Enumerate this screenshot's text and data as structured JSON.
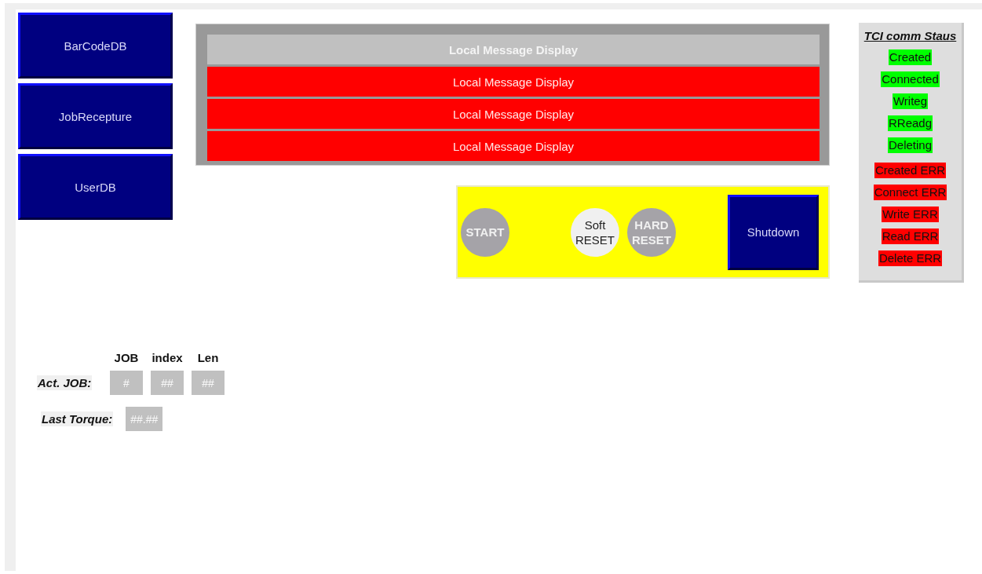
{
  "nav_buttons": [
    {
      "label": "BarCodeDB"
    },
    {
      "label": "JobRecepture"
    },
    {
      "label": "UserDB"
    }
  ],
  "message_display": {
    "header": "Local Message Display",
    "rows": [
      "Local Message Display",
      "Local Message Display",
      "Local Message Display"
    ]
  },
  "controls": {
    "round_buttons": [
      {
        "label": "START",
        "active": false
      },
      {
        "label": "Soft RESET",
        "active": true
      },
      {
        "label": "HARD RESET",
        "active": false
      }
    ],
    "shutdown": "Shutdown"
  },
  "tci_status": {
    "title": "TCI comm Staus",
    "items": [
      {
        "label": "Created",
        "color": "#00ff00"
      },
      {
        "label": "Connected",
        "color": "#00ff00"
      },
      {
        "label": "Writeg",
        "color": "#00ff00"
      },
      {
        "label": "RReadg",
        "color": "#00ff00"
      },
      {
        "label": "Deleting",
        "color": "#00ff00"
      },
      {
        "label": "Created ERR",
        "color": "#ff0000"
      },
      {
        "label": "Connect ERR",
        "color": "#ff0000"
      },
      {
        "label": "Write ERR",
        "color": "#ff0000"
      },
      {
        "label": "Read ERR",
        "color": "#ff0000"
      },
      {
        "label": "Delete ERR",
        "color": "#ff0000"
      }
    ]
  },
  "job_info": {
    "columns": [
      "JOB",
      "index",
      "Len"
    ],
    "act_job": {
      "label": "Act. JOB:",
      "values": [
        "#",
        "##",
        "##"
      ]
    },
    "last_torque": {
      "label": "Last Torque:",
      "value": "##.##"
    }
  }
}
